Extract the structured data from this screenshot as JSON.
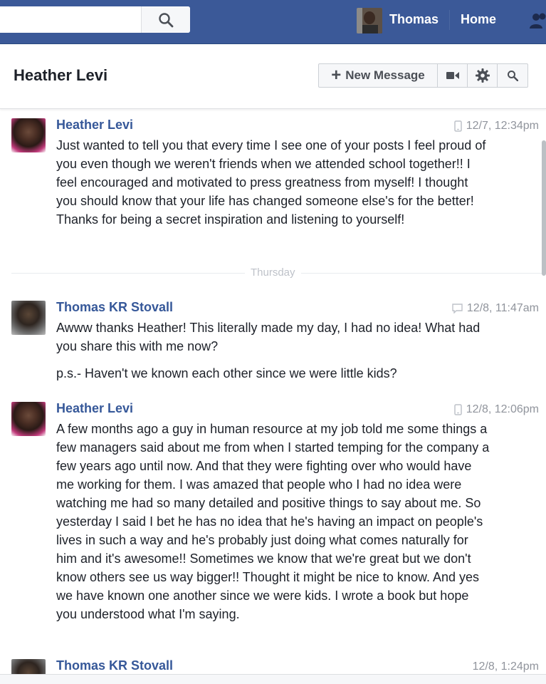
{
  "topbar": {
    "search_placeholder": "",
    "user_name": "Thomas",
    "home_label": "Home",
    "icons": [
      "search-icon",
      "friends-icon"
    ]
  },
  "header": {
    "conversation_title": "Heather Levi",
    "new_message_label": "New Message",
    "icons": [
      "video-call-icon",
      "gear-icon",
      "search-icon"
    ]
  },
  "messages": [
    {
      "sender": "Heather Levi",
      "time": "12/7, 12:34pm",
      "device": "mobile-icon",
      "body": "Just wanted to tell you that every time I see one of your posts I feel proud of you even though we weren't friends when we attended school together!! I feel encouraged and motivated to press greatness from myself! I thought you should know that your life has changed someone else's for the better! Thanks for being a secret inspiration and listening to yourself!"
    },
    {
      "sender": "Thomas KR Stovall",
      "time": "12/8, 11:47am",
      "device": "chat-icon",
      "body": "Awww thanks Heather! This literally made my day, I had no idea! What had you share this with me now?",
      "body2": "p.s.- Haven't we known each other since we were little kids?"
    },
    {
      "sender": "Heather Levi",
      "time": "12/8, 12:06pm",
      "device": "mobile-icon",
      "body": "A few months ago a guy in human resource at my job told me some things a few managers said about me from when I started temping for the company a few years ago until now. And that they were fighting over who would have me working for them. I was amazed that people who I had no idea were watching me had so many detailed and positive things to say about me. So yesterday I said I bet he has no idea that he's having an impact on people's lives in such a way and he's probably just doing what comes naturally for him and it's awesome!! Sometimes we know that we're great but we don't know others see us way bigger!! Thought it might be nice to know.  And yes we have known one another since we were kids. I wrote a book but hope you understood what I'm saying."
    },
    {
      "sender": "Thomas KR Stovall",
      "time": "12/8, 1:24pm"
    }
  ],
  "divider_label": "Thursday",
  "colors": {
    "brand_blue": "#3b5998",
    "sender_blue": "#365899",
    "timestamp_gray": "#90949c"
  }
}
